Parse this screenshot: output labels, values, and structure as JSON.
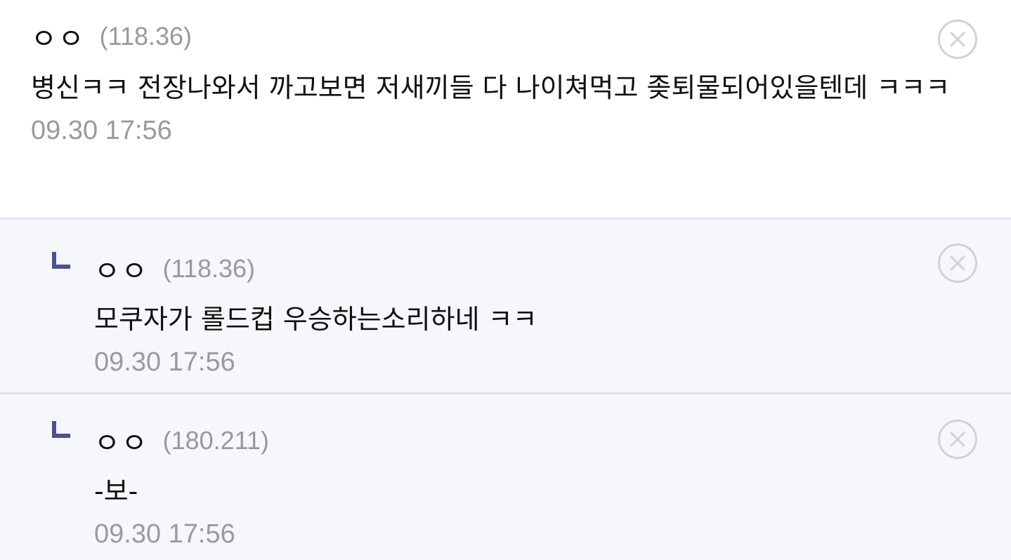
{
  "comments": [
    {
      "nickname": "ㅇㅇ",
      "ip": "(118.36)",
      "text": "병신ㅋㅋ 전장나와서 까고보면 저새끼들 다 나이쳐먹고 좆퇴물되어있을텐데 ㅋㅋㅋ",
      "date": "09.30 17:56",
      "delete_icon": "close-circle-icon"
    }
  ],
  "replies": [
    {
      "nickname": "ㅇㅇ",
      "ip": "(118.36)",
      "text": "모쿠자가 롤드컵 우승하는소리하네 ㅋㅋ",
      "date": "09.30 17:56",
      "reply_icon": "reply-corner-icon",
      "delete_icon": "close-circle-icon"
    },
    {
      "nickname": "ㅇㅇ",
      "ip": "(180.211)",
      "text": "-보-",
      "date": "09.30 17:56",
      "reply_icon": "reply-corner-icon",
      "delete_icon": "close-circle-icon"
    }
  ],
  "colors": {
    "reply_bg": "#f6f7fa",
    "divider": "#e1e3ee",
    "reply_mark": "#4b509a",
    "meta_gray": "#999999",
    "delete_icon": "#d2d2d2"
  }
}
